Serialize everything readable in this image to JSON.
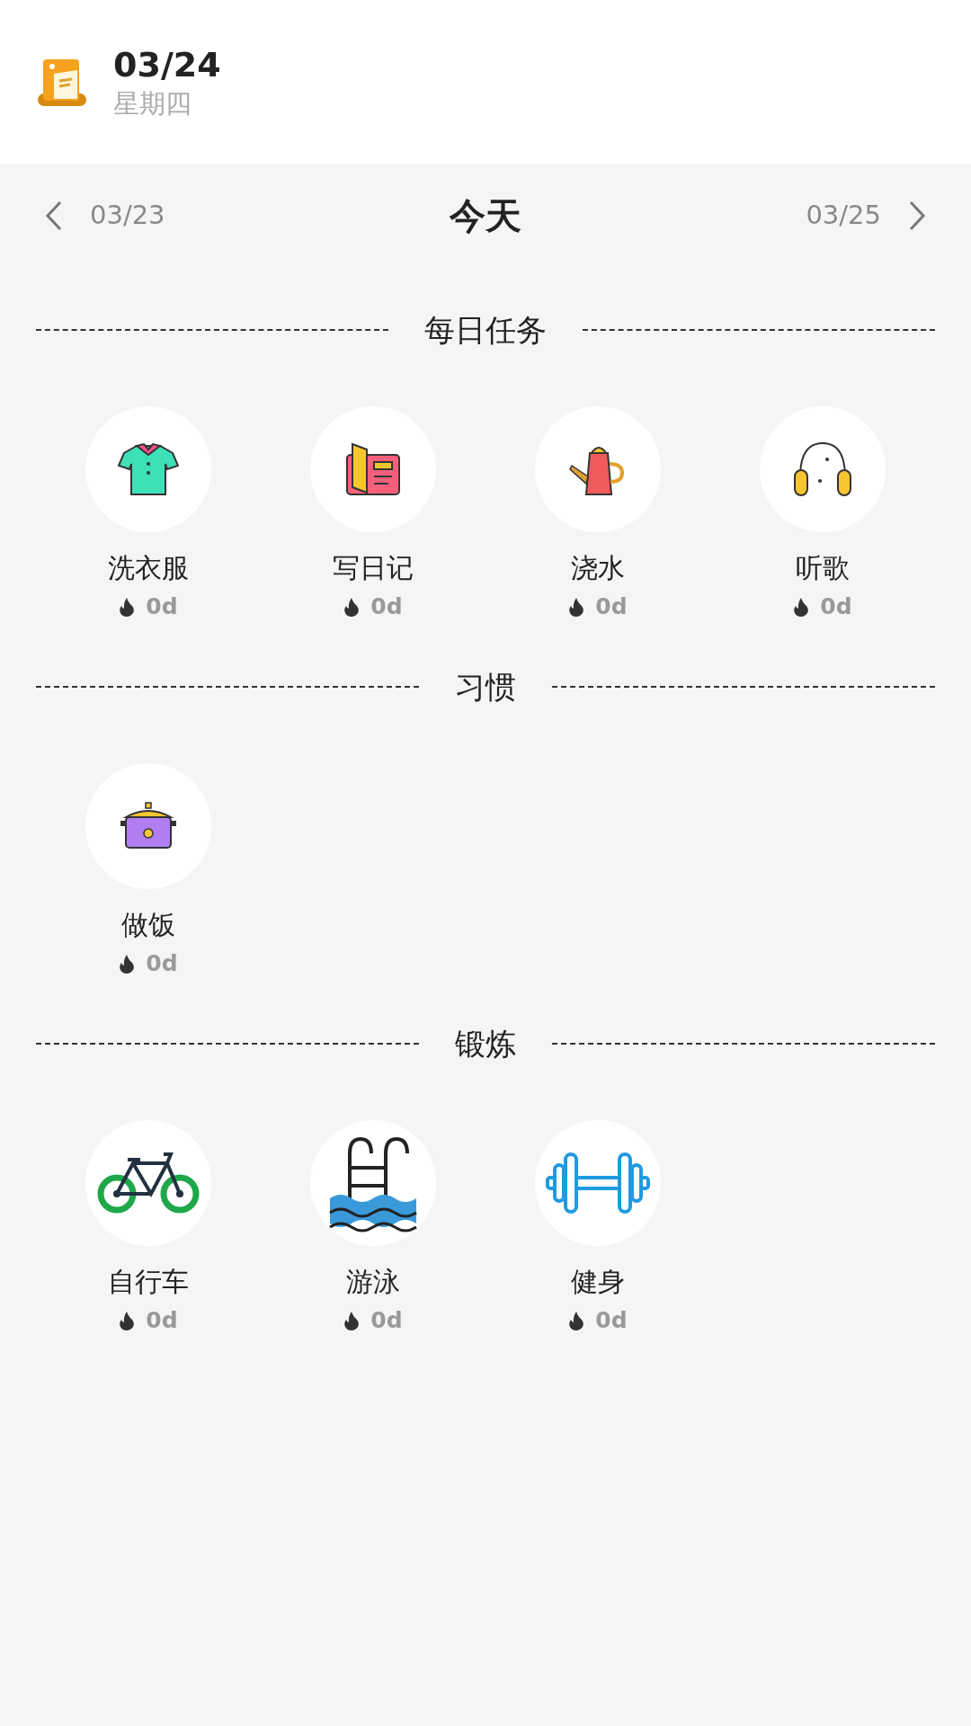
{
  "header": {
    "date": "03/24",
    "weekday": "星期四"
  },
  "nav": {
    "prev": "03/23",
    "current": "今天",
    "next": "03/25"
  },
  "sections": [
    {
      "title": "每日任务",
      "items": [
        {
          "name": "洗衣服",
          "streak": "0d",
          "kind": "shirt"
        },
        {
          "name": "写日记",
          "streak": "0d",
          "kind": "book"
        },
        {
          "name": "浇水",
          "streak": "0d",
          "kind": "watering-can"
        },
        {
          "name": "听歌",
          "streak": "0d",
          "kind": "headphones"
        }
      ]
    },
    {
      "title": "习惯",
      "items": [
        {
          "name": "做饭",
          "streak": "0d",
          "kind": "pot"
        }
      ]
    },
    {
      "title": "锻炼",
      "items": [
        {
          "name": "自行车",
          "streak": "0d",
          "kind": "bicycle"
        },
        {
          "name": "游泳",
          "streak": "0d",
          "kind": "pool-ladder"
        },
        {
          "name": "健身",
          "streak": "0d",
          "kind": "dumbbell"
        }
      ]
    }
  ]
}
